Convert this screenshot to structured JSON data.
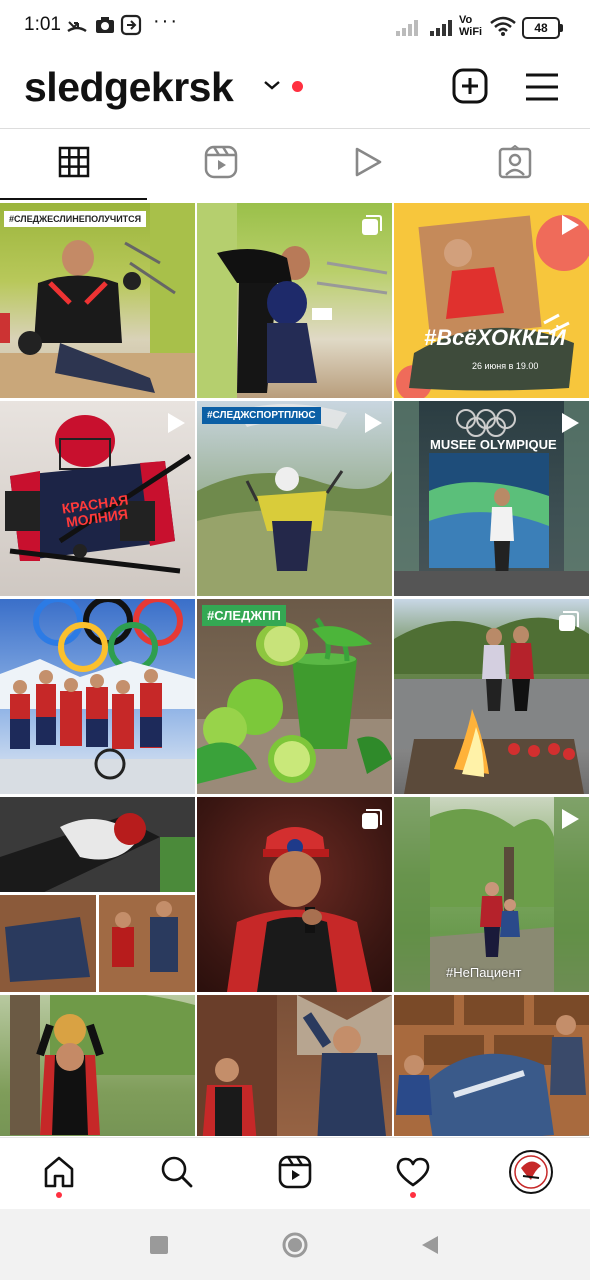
{
  "status": {
    "time": "1:01",
    "dots": "···",
    "network": "Vo\nWiFi",
    "battery": "48"
  },
  "header": {
    "username": "sledgekrsk"
  },
  "tabs": [
    {
      "name": "grid",
      "active": true
    },
    {
      "name": "reels",
      "active": false
    },
    {
      "name": "videos",
      "active": false
    },
    {
      "name": "tagged",
      "active": false
    }
  ],
  "posts": {
    "p1_tag": "#СЛЕДЖЕСЛИНЕПОЛУЧИТСЯ",
    "p3_title": "#ВсёХОККЕЙ",
    "p3_date": "26 июня в 19.00",
    "p4_jersey": "КРАСНАЯ МОЛНИЯ",
    "p5_tag": "#СЛЕДЖСПОРТПЛЮС",
    "p6_sign": "MUSEE OLYMPIQUE",
    "p8_tag": "#СЛЕДЖПП",
    "p12_tag": "#НеПациент"
  },
  "colors": {
    "accent_red": "#ff3040",
    "text": "#111111",
    "tag_blue": "#0b5fa5",
    "tag_green": "#34a853"
  }
}
